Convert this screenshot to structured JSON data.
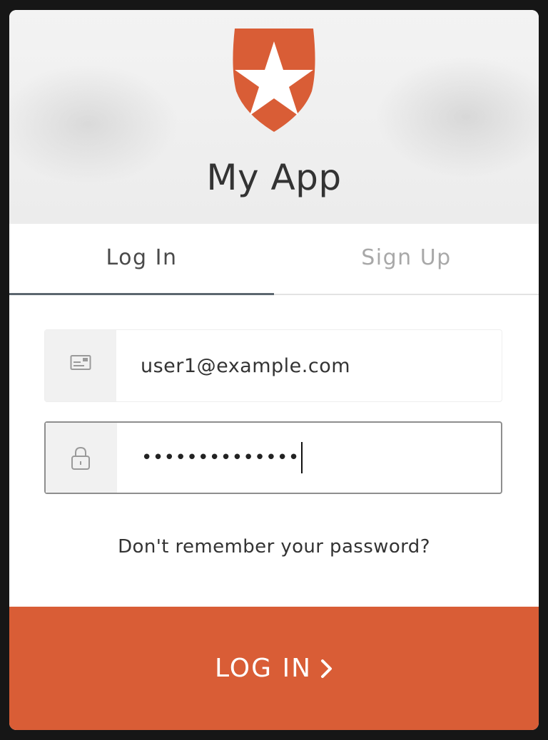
{
  "app": {
    "title": "My App",
    "brand_color": "#d95d36"
  },
  "tabs": [
    {
      "label": "Log In",
      "active": true
    },
    {
      "label": "Sign Up",
      "active": false
    }
  ],
  "email": {
    "icon": "envelope-icon",
    "value": "user1@example.com"
  },
  "password": {
    "icon": "lock-icon",
    "masked_value": "••••••••••••••"
  },
  "forgot_link": "Don't remember your password?",
  "submit": {
    "label": "LOG IN",
    "icon": "chevron-right-icon"
  }
}
